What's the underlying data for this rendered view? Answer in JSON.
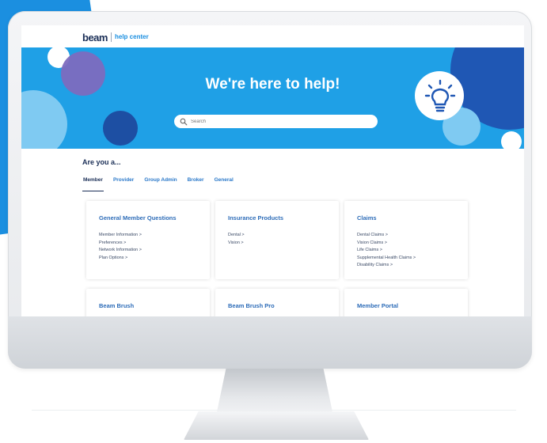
{
  "brand": {
    "logo": "beam",
    "subtitle": "help center"
  },
  "hero": {
    "title": "We're here to help!",
    "search_placeholder": "Search",
    "icon": "lightbulb-icon"
  },
  "section": {
    "title": "Are you a...",
    "tabs": [
      {
        "label": "Member",
        "active": true
      },
      {
        "label": "Provider",
        "active": false
      },
      {
        "label": "Group Admin",
        "active": false
      },
      {
        "label": "Broker",
        "active": false
      },
      {
        "label": "General",
        "active": false
      }
    ]
  },
  "cards": [
    {
      "title": "General Member Questions",
      "links": [
        "Member Information >",
        "Preferences >",
        "Network Information >",
        "Plan Options >"
      ]
    },
    {
      "title": "Insurance Products",
      "links": [
        "Dental >",
        "Vision >"
      ]
    },
    {
      "title": "Claims",
      "links": [
        "Dental Claims >",
        "Vision Claims >",
        "Life Claims >",
        "Supplemental Health Claims >",
        "Disability Claims >"
      ]
    },
    {
      "title": "Beam Brush",
      "links": []
    },
    {
      "title": "Beam Brush Pro",
      "links": []
    },
    {
      "title": "Member Portal",
      "links": []
    }
  ],
  "colors": {
    "hero_blue": "#1fa0e6",
    "dark_blue": "#1f57b4",
    "navy_text": "#1b2f57",
    "link_blue": "#2d6cb8",
    "purple": "#7d6bbf",
    "light_blue": "#7fcaf2"
  }
}
